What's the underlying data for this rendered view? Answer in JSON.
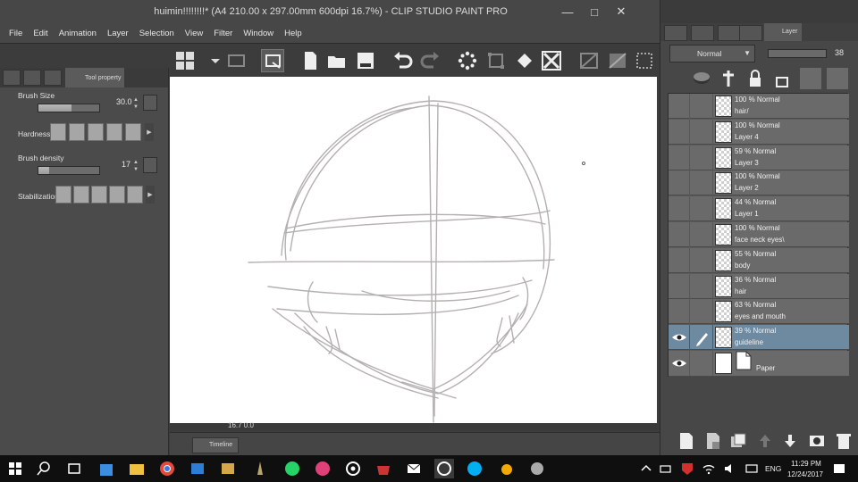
{
  "window": {
    "title": "huimin!!!!!!!!* (A4 210.00 x 297.00mm 600dpi 16.7%)  - CLIP STUDIO PAINT PRO",
    "controls": [
      "—",
      "□",
      "✕"
    ]
  },
  "menu": [
    "File",
    "Edit",
    "Animation",
    "Layer",
    "Selection",
    "View",
    "Filter",
    "Window",
    "Help"
  ],
  "tool_property": {
    "tab_label": "Tool property",
    "brush_size": {
      "label": "Brush Size",
      "value": "30.0",
      "fraction": 0.55
    },
    "hardness": {
      "label": "Hardness"
    },
    "brush_density": {
      "label": "Brush density",
      "value": "17",
      "fraction": 0.17
    },
    "stabilization": {
      "label": "Stabilization"
    }
  },
  "canvas": {
    "zoom": "16.7 0.0"
  },
  "timeline": {
    "tab_label": "Timeline"
  },
  "layer_panel": {
    "tab_label": "Layer",
    "blend_mode": "Normal",
    "opacity": "38",
    "layers": [
      {
        "opacity": "100 % Normal",
        "name": "hair/"
      },
      {
        "opacity": "100 % Normal",
        "name": "Layer 4"
      },
      {
        "opacity": "59 % Normal",
        "name": "Layer 3"
      },
      {
        "opacity": "100 % Normal",
        "name": "Layer 2"
      },
      {
        "opacity": "44 % Normal",
        "name": "Layer 1"
      },
      {
        "opacity": "100 % Normal",
        "name": "face neck eyes\\"
      },
      {
        "opacity": "55 % Normal",
        "name": "body"
      },
      {
        "opacity": "36 % Normal",
        "name": "hair"
      },
      {
        "opacity": "63 % Normal",
        "name": "eyes and mouth"
      },
      {
        "opacity": "39 % Normal",
        "name": "guideline",
        "selected": true,
        "visible": true
      },
      {
        "opacity": "",
        "name": "Paper",
        "paper": true,
        "visible": true
      }
    ]
  },
  "taskbar": {
    "language": "ENG",
    "time": "11:29 PM",
    "date": "12/24/2017"
  },
  "colors": {
    "selected_layer": "#6e8aa0",
    "chrome": "#474747",
    "canvas": "#ffffff"
  }
}
